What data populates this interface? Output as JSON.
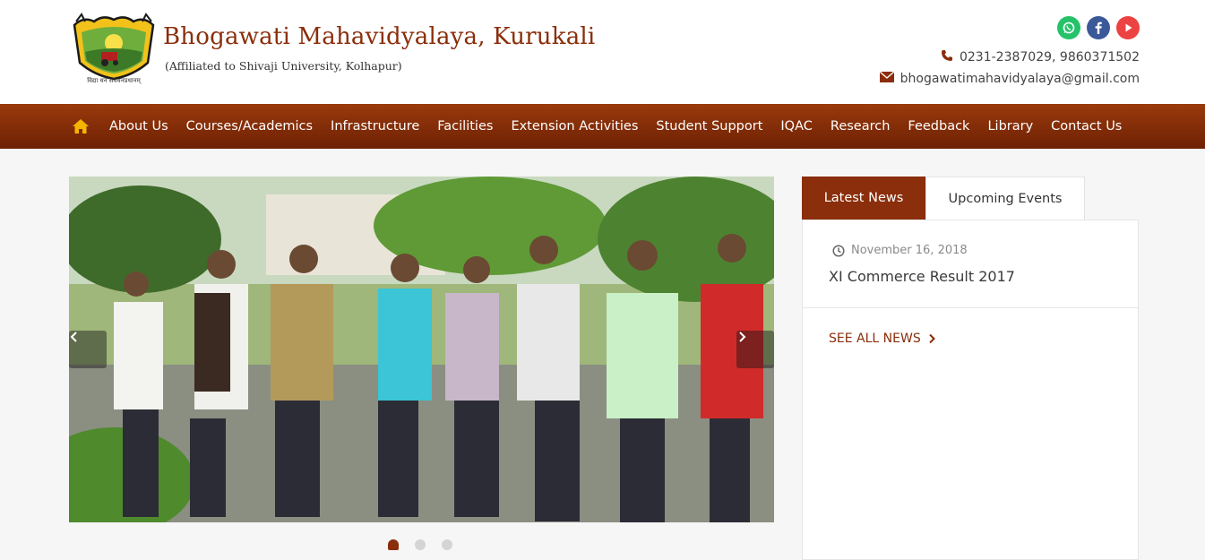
{
  "header": {
    "logo_caption": "विद्या धनं सर्वधनप्रधानम्",
    "title": "Bhogawati Mahavidyalaya, Kurukali",
    "subtitle": "(Affiliated to Shivaji University, Kolhapur)",
    "phone": "0231-2387029, 9860371502",
    "email": "bhogawatimahavidyalaya@gmail.com",
    "socials": [
      "whatsapp-icon",
      "facebook-icon",
      "youtube-icon"
    ]
  },
  "nav": {
    "home_icon": "home-icon",
    "items": [
      {
        "label": "About Us"
      },
      {
        "label": "Courses/Academics"
      },
      {
        "label": "Infrastructure"
      },
      {
        "label": "Facilities"
      },
      {
        "label": "Extension Activities"
      },
      {
        "label": "Student Support"
      },
      {
        "label": "IQAC"
      },
      {
        "label": "Research"
      },
      {
        "label": "Feedback"
      },
      {
        "label": "Library"
      },
      {
        "label": "Contact Us"
      }
    ]
  },
  "slider": {
    "active_slide": 1,
    "slide_count": 3
  },
  "news": {
    "tabs": [
      {
        "label": "Latest News",
        "active": true
      },
      {
        "label": "Upcoming Events",
        "active": false
      }
    ],
    "items": [
      {
        "date": "November 16, 2018",
        "title": "XI Commerce Result 2017"
      }
    ],
    "see_all": "SEE ALL NEWS"
  },
  "colors": {
    "brand": "#8a2e0b",
    "nav_top": "#9a3a0c",
    "nav_bottom": "#6e2104",
    "home_icon": "#f5b400",
    "whatsapp": "#25c26a",
    "facebook": "#3b5998",
    "youtube": "#ec4242"
  }
}
